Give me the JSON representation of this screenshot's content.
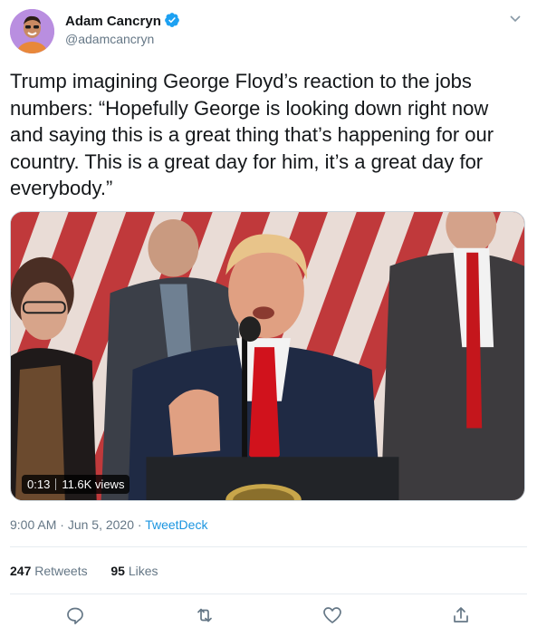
{
  "author": {
    "name": "Adam Cancryn",
    "handle": "@adamcancryn",
    "verified": true
  },
  "tweet": {
    "text": "Trump imagining George Floyd’s reaction to the jobs numbers: “Hopefully George is looking down right now and saying this is a great thing that’s happening for our country. This is a great day for him, it’s a great day for everybody.”",
    "time": "9:00 AM",
    "separator": "·",
    "date": "Jun 5, 2020",
    "source": "TweetDeck"
  },
  "media": {
    "type": "video",
    "duration": "0:13",
    "views": "11.6K views"
  },
  "stats": {
    "retweets_count": "247",
    "retweets_label": "Retweets",
    "likes_count": "95",
    "likes_label": "Likes"
  },
  "actions": {
    "reply_icon": "reply-icon",
    "retweet_icon": "retweet-icon",
    "like_icon": "heart-icon",
    "share_icon": "share-icon"
  },
  "colors": {
    "accent": "#1b95e0",
    "verified": "#1da1f2",
    "muted": "#657786",
    "divider": "#e6ecf0"
  }
}
